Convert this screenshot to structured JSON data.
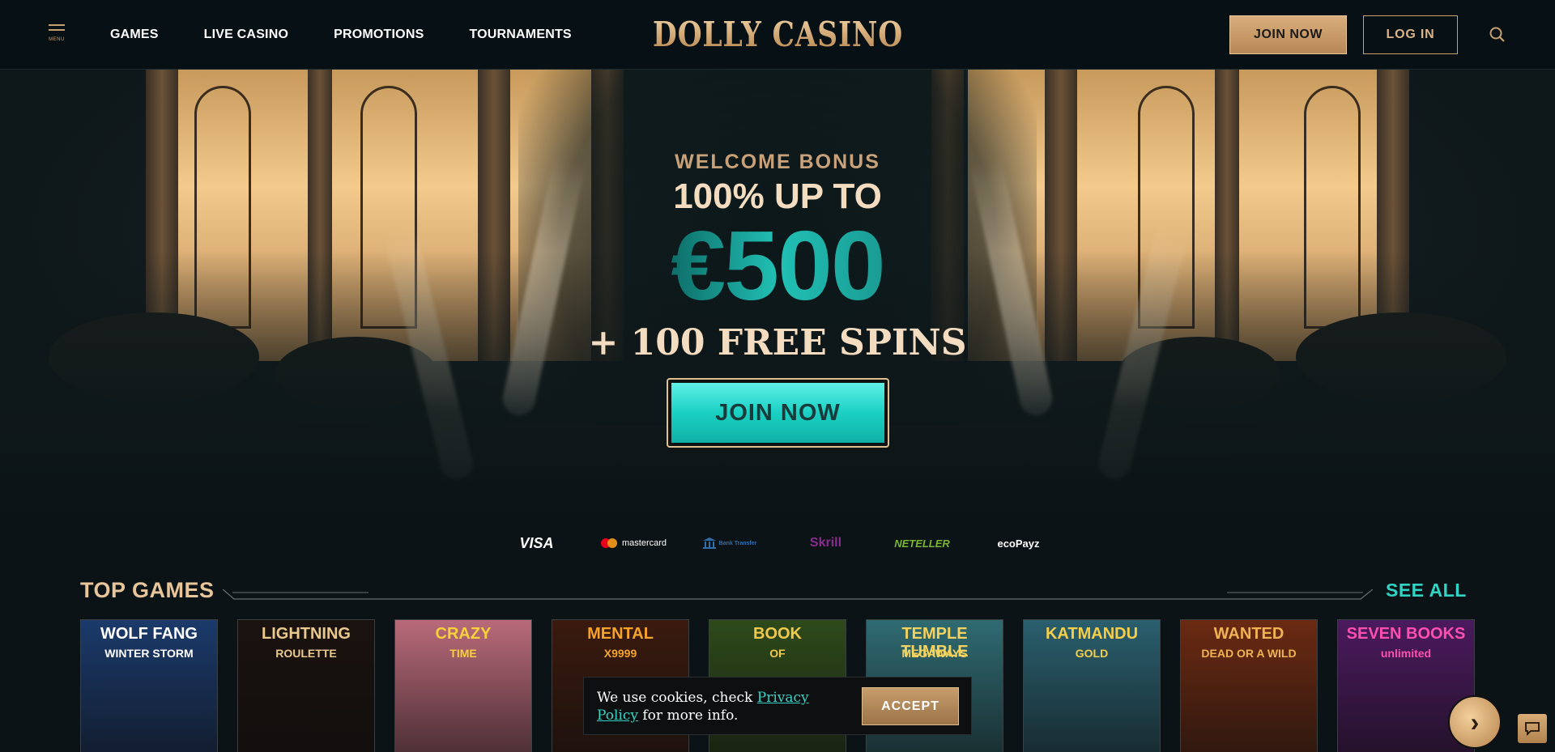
{
  "header": {
    "menu_label": "MENU",
    "nav": [
      "GAMES",
      "LIVE CASINO",
      "PROMOTIONS",
      "TOURNAMENTS"
    ],
    "logo": "DOLLY CASINO",
    "join_label": "JOIN NOW",
    "login_label": "LOG IN",
    "search_icon": "search-icon"
  },
  "hero": {
    "subtitle": "WELCOME BONUS",
    "line1": "100% UP TO",
    "amount": "€500",
    "spins": "+ 100 FREE SPINS",
    "cta": "JOIN NOW"
  },
  "payments": [
    {
      "label": "VISA",
      "color": "#ffffff"
    },
    {
      "label": "mastercard",
      "color": "#ffffff"
    },
    {
      "label": "Bank Transfer",
      "color": "#2f6fb0"
    },
    {
      "label": "Skrill",
      "color": "#8a2c8e"
    },
    {
      "label": "NETELLER",
      "color": "#7ab532"
    },
    {
      "label": "ecoPayz",
      "color": "#ffffff"
    }
  ],
  "top_games": {
    "title": "TOP GAMES",
    "see_all": "SEE ALL",
    "games": [
      {
        "name": "WOLF FANG",
        "sub": "WINTER STORM",
        "bg": "#1b3a6b",
        "color": "#ffffff"
      },
      {
        "name": "LIGHTNING",
        "sub": "ROULETTE",
        "bg": "#1a120e",
        "color": "#e9c98c"
      },
      {
        "name": "CRAZY",
        "sub": "TIME",
        "bg": "#b96a7a",
        "color": "#f7d13a"
      },
      {
        "name": "MENTAL",
        "sub": "X9999",
        "bg": "#3a1a0e",
        "color": "#f5a42a"
      },
      {
        "name": "BOOK",
        "sub": "OF",
        "bg": "#2e4a1a",
        "color": "#f1c94d"
      },
      {
        "name": "TEMPLE TUMBLE",
        "sub": "MEGAWAYS",
        "bg": "#2f6b72",
        "color": "#f3d25e"
      },
      {
        "name": "KATMANDU",
        "sub": "GOLD",
        "bg": "#2a5f6e",
        "color": "#f6cf4a"
      },
      {
        "name": "WANTED",
        "sub": "DEAD OR A WILD",
        "bg": "#6b2a12",
        "color": "#f0b354"
      },
      {
        "name": "SEVEN BOOKS",
        "sub": "unlimited",
        "bg": "#4b1a5e",
        "color": "#ff4fb0"
      }
    ]
  },
  "cookie": {
    "text_before": "We use cookies, check ",
    "link": "Privacy Policy",
    "text_after": " for more info.",
    "accept": "ACCEPT"
  },
  "next_arrow": "›",
  "chat_icon": "chat-icon"
}
